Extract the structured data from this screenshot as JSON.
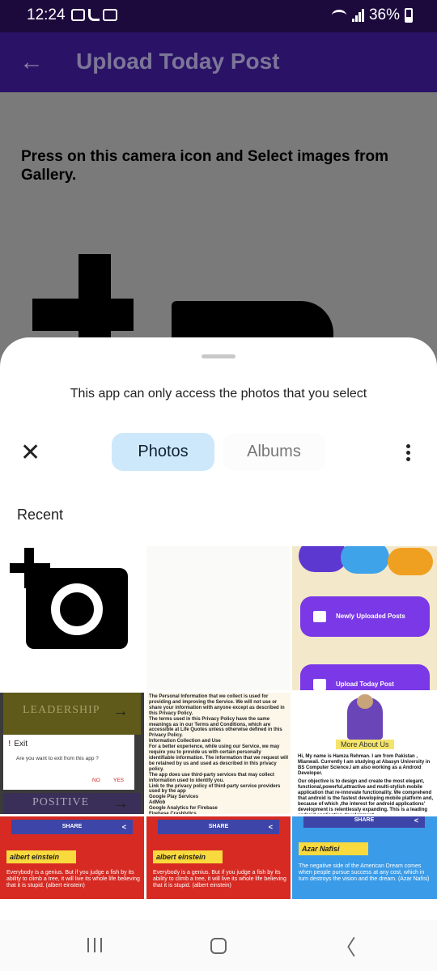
{
  "status": {
    "time": "12:24",
    "battery": "36%",
    "battery_level": 0.36
  },
  "appbar": {
    "title": "Upload Today Post",
    "back": "←"
  },
  "content": {
    "instruction": "Press on this camera icon and Select images from Gallery."
  },
  "picker": {
    "notice": "This app can only access the photos that you select",
    "close": "✕",
    "tabs": [
      "Photos",
      "Albums"
    ],
    "active_tab": "Photos",
    "section": "Recent"
  },
  "tiles": {
    "t3": {
      "btn1": "Newly Uploaded Posts",
      "btn2": "Upload Today Post"
    },
    "t4": {
      "lead": "LEADERSHIP",
      "positive": "POSITIVE",
      "arrow": "→",
      "dialog_title": "Exit",
      "dialog_icon": "!",
      "dialog_msg": "Are you want to exit from this app ?",
      "no": "NO",
      "yes": "YES"
    },
    "t5": {
      "text": "The Personal Information that we collect is used for providing and improving the Service. We will not use or share your information with anyone except as described in this Privacy Policy.\nThe terms used in this Privacy Policy have the same meanings as in our Terms and Conditions, which are accessible at Life Quotes unless otherwise defined in this Privacy Policy.\nInformation Collection and Use\nFor a better experience, while using our Service, we may require you to provide us with certain personally identifiable information. The information that we request will be retained by us and used as described in this privacy policy.\nThe app does use third-party services that may collect information used to identify you.\nLink to the privacy policy of third-party service providers used by the app\nGoogle Play Services\nAdMob\nGoogle Analytics for Firebase\nFirebase Crashlytics\nOne Signal"
    },
    "t6": {
      "tag": "More About Us",
      "bio1": "Hi, My name is Hamza Rehman. I am from Pakistan , Mianwali. Currently I am studying at Abasyn University in BS Computer Science.I am also working as a Android Developer.",
      "bio2": "Our objective is to design and create the most elegant, functional,powerful,attractive and multi-stylish mobile application that re-innovate functionality. We comprehend that android is the fastest developing mobile platform and, because of which ,the interest for android applications' development is relentlessly expanding. This is a leading android application development"
    },
    "t7": {
      "share": "SHARE",
      "share_icon": "<",
      "name": "albert einstein",
      "quote": "Everybody is a genius. But if you judge a fish by its ability to climb a tree, it will live its whole life believing that it is stupid. (albert einstein)"
    },
    "t8": {
      "share": "SHARE",
      "share_icon": "<",
      "name": "albert einstein",
      "quote": "Everybody is a genius. But if you judge a fish by its ability to climb a tree, it will live its whole life believing that it is stupid. (albert einstein)"
    },
    "t9": {
      "share": "SHARE",
      "share_icon": "<",
      "name": "Azar Nafisi",
      "quote": "The negative side of the American Dream comes when people pursue success at any cost, which in turn destroys the vision and the dream. (Azar Nafisi)"
    }
  },
  "navbar": {
    "back": "〈"
  },
  "colors": {
    "appbar": "#2a1266",
    "tab_active": "#cde8fb",
    "accent_purple": "#7a38e6"
  }
}
